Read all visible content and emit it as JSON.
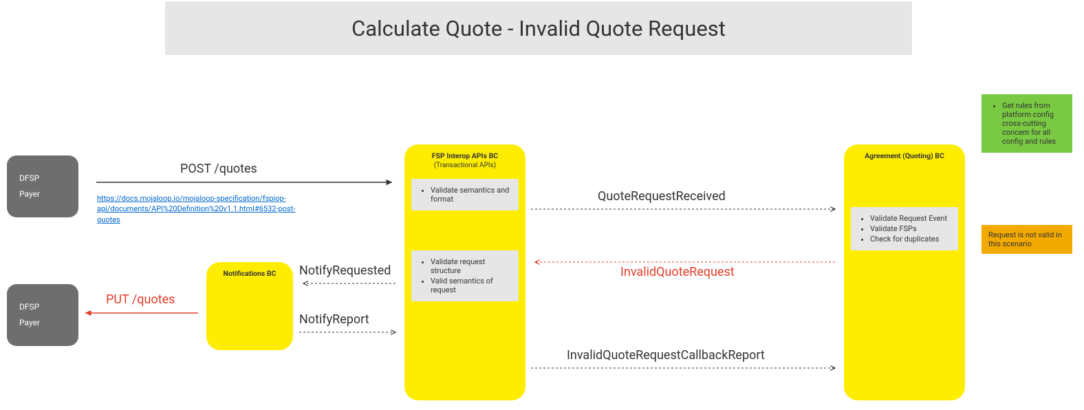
{
  "title": "Calculate Quote - Invalid Quote Request",
  "dfsp1": {
    "line1": "DFSP",
    "line2": "Payer"
  },
  "dfsp2": {
    "line1": "DFSP",
    "line2": "Payer"
  },
  "notifications_bc": {
    "title": "Notifications BC"
  },
  "fsp_bc": {
    "title": "FSP Interop APIs BC",
    "subtitle": "(Transactional APIs)",
    "note1_item1": "Validate semantics and format",
    "note2_item1": "Validate request structure",
    "note2_item2": "Valid semantics of request"
  },
  "agreement_bc": {
    "title": "Agreement (Quoting) BC",
    "note_item1": "Validate Request Event",
    "note_item2": "Validate FSPs",
    "note_item3": "Check for duplicates"
  },
  "green_note": {
    "item1": "Get rules from platform config cross-cutting concern for all config and rules"
  },
  "orange_note": "Request is not valid in this scenario",
  "arrows": {
    "post_quotes": "POST /quotes",
    "quote_request_received": "QuoteRequestReceived",
    "invalid_quote_request": "InvalidQuoteRequest",
    "invalid_callback_report": "InvalidQuoteRequestCallbackReport",
    "notify_requested": "NotifyRequested",
    "notify_report": "NotifyReport",
    "put_quotes": "PUT /quotes"
  },
  "link_text": "https://docs.mojaloop.io/mojaloop-specification/fspiop-api/documents/API%20Definition%20v1.1.html#6532-post-quotes"
}
